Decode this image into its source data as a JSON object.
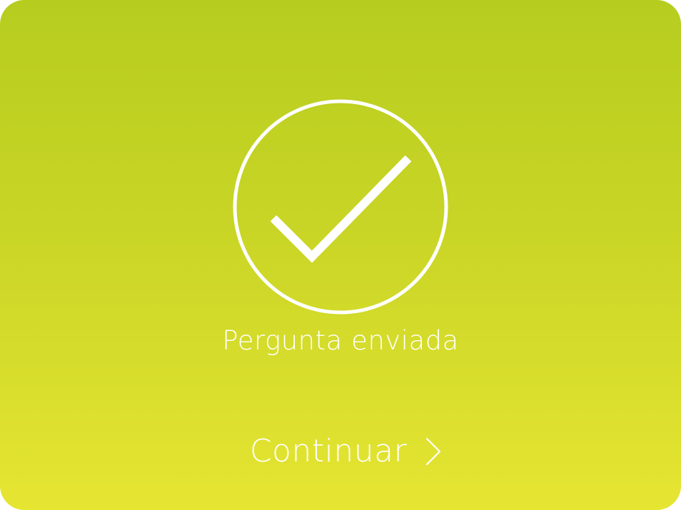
{
  "confirmation": {
    "icon": "checkmark-circle-icon",
    "message": "Pergunta enviada"
  },
  "actions": {
    "continue_label": "Continuar",
    "continue_icon": "chevron-right-icon"
  },
  "colors": {
    "gradient_top": "#b6cd1f",
    "gradient_bottom": "#e6e532",
    "foreground": "#ffffff"
  }
}
